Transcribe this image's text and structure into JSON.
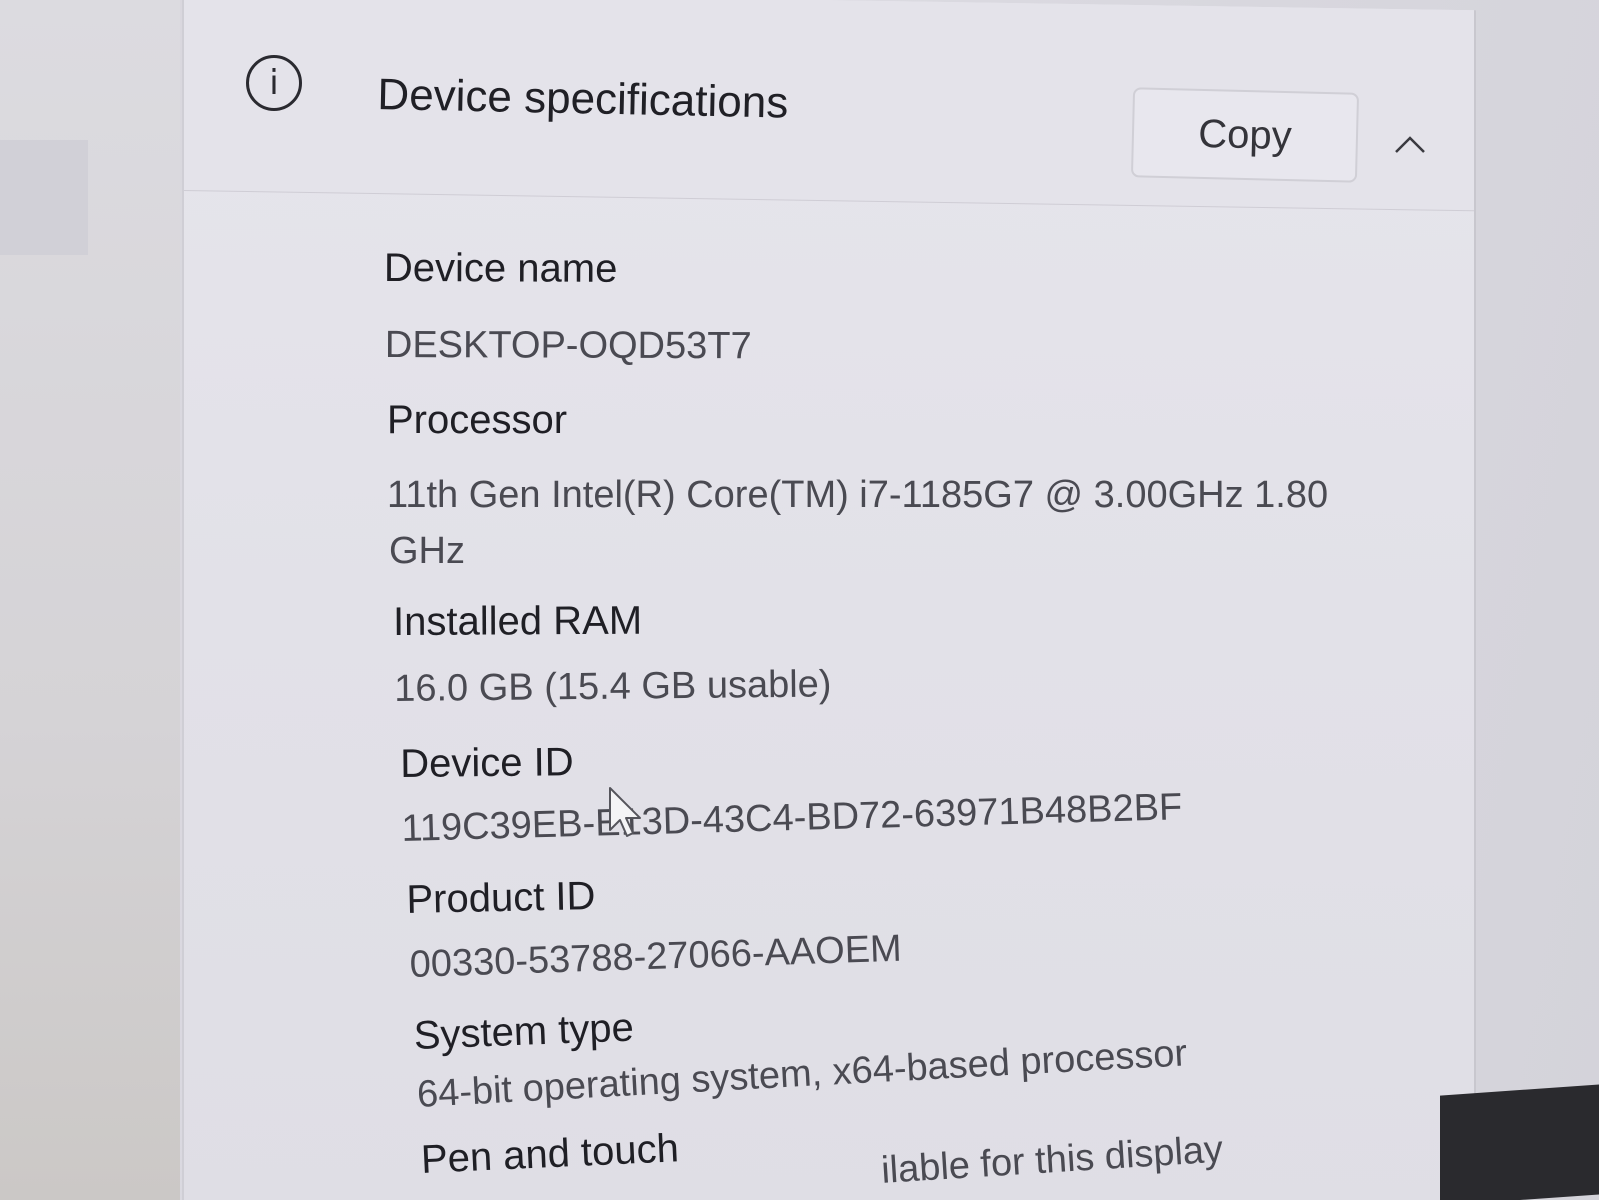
{
  "section": {
    "title": "Device specifications",
    "copy_label": "Copy",
    "info_icon_glyph": "i",
    "icons": [
      "info-icon",
      "chevron-up-icon",
      "mouse-cursor-icon"
    ]
  },
  "specs": {
    "device_name": {
      "label": "Device name",
      "value": "DESKTOP-OQD53T7"
    },
    "processor": {
      "label": "Processor",
      "value_line1": "11th Gen Intel(R) Core(TM) i7-1185G7 @ 3.00GHz   1.80",
      "value_line2": "GHz"
    },
    "installed_ram": {
      "label": "Installed RAM",
      "value": "16.0 GB (15.4 GB usable)"
    },
    "device_id": {
      "label": "Device ID",
      "value": "119C39EB-E13D-43C4-BD72-63971B48B2BF"
    },
    "product_id": {
      "label": "Product ID",
      "value": "00330-53788-27066-AAOEM"
    },
    "system_type": {
      "label": "System type",
      "value": "64-bit operating system, x64-based processor"
    },
    "pen_and_touch": {
      "label": "Pen and touch",
      "value_partial": "ilable for this display"
    }
  }
}
